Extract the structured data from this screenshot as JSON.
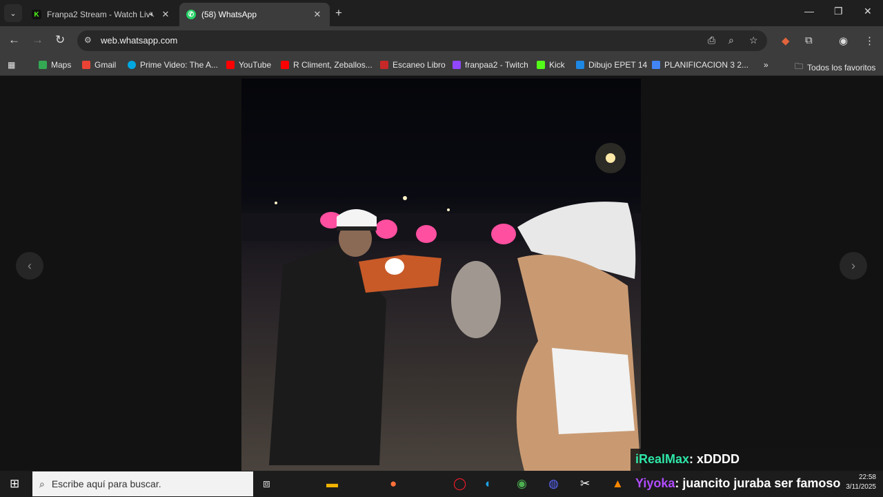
{
  "tabs": [
    {
      "title": "Franpa2 Stream - Watch Liv",
      "favicon": "kick-logo-icon"
    },
    {
      "title": "(58) WhatsApp",
      "favicon": "whatsapp-icon"
    }
  ],
  "address": {
    "url": "web.whatsapp.com"
  },
  "bookmarks": [
    {
      "label": "Maps",
      "color": "#34a853"
    },
    {
      "label": "Gmail",
      "color": "#ea4335"
    },
    {
      "label": "Prime Video: The A...",
      "color": "#00a8e1"
    },
    {
      "label": "YouTube",
      "color": "#ff0000"
    },
    {
      "label": "R Climent, Zeballos...",
      "color": "#ff0000"
    },
    {
      "label": "Escaneo Libro",
      "color": "#c62828"
    },
    {
      "label": "franpaa2 - Twitch",
      "color": "#9146ff"
    },
    {
      "label": "Kick",
      "color": "#53fc18"
    },
    {
      "label": "Dibujo EPET 14",
      "color": "#1e88e5"
    },
    {
      "label": "PLANIFICACION 3 2...",
      "color": "#4285f4"
    }
  ],
  "bookmarks_more": "»",
  "bookmarks_all": "Todos los favoritos",
  "chat": {
    "line1": {
      "user": "iRealMax",
      "user_color": "#2ee6a6",
      "text": ": xDDDD"
    },
    "line2": {
      "user": "Yiyoka",
      "user_color": "#b04cff",
      "text": ": juancito juraba ser famoso"
    }
  },
  "taskbar": {
    "search_placeholder": "Escribe aquí para buscar."
  },
  "clock": {
    "time": "22:58",
    "date": "3/11/2025"
  }
}
